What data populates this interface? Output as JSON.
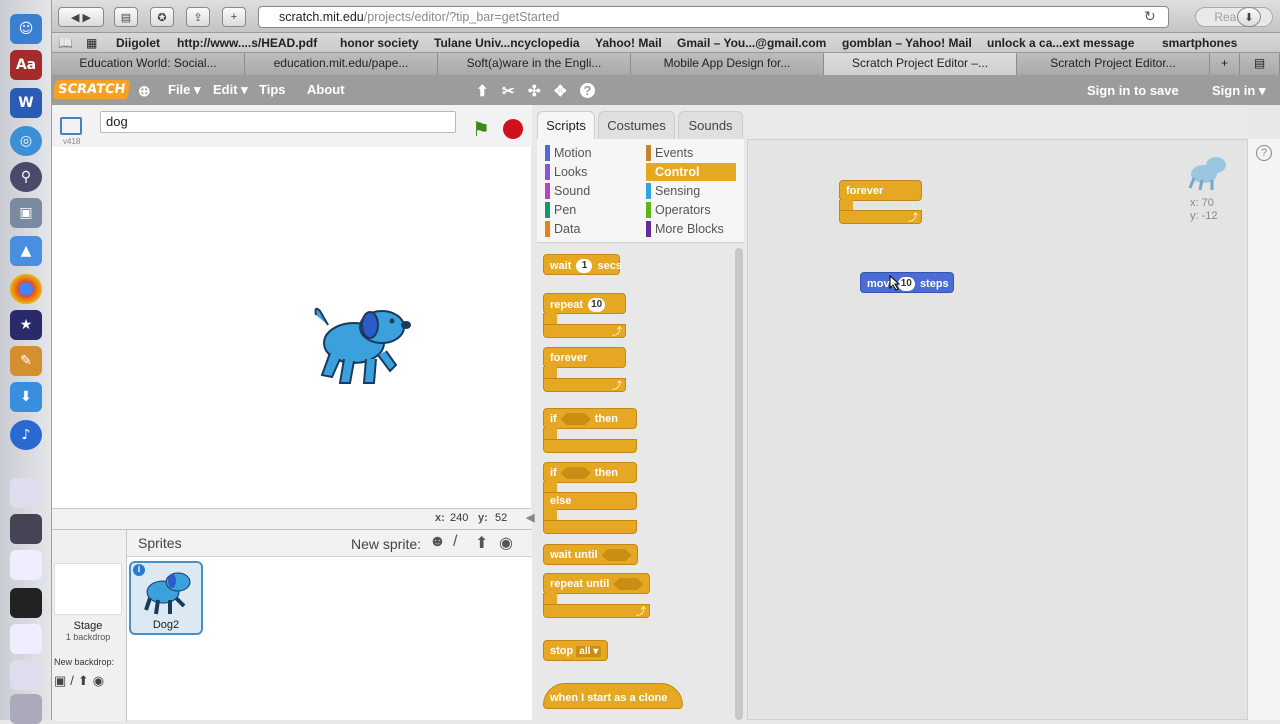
{
  "browser": {
    "url_host": "scratch.mit.edu",
    "url_path": "/projects/editor/?tip_bar=getStarted",
    "reader_label": "Reader"
  },
  "bookmarks": [
    "Diigolet",
    "http://www....s/HEAD.pdf",
    "honor society",
    "Tulane Univ...ncyclopedia",
    "Yahoo! Mail",
    "Gmail – You...@gmail.com",
    "gomblan – Yahoo! Mail",
    "unlock a ca...ext message",
    "smartphones"
  ],
  "tabs": [
    "Education World: Social...",
    "education.mit.edu/pape...",
    "Soft(a)ware in the Engli...",
    "Mobile App Design for...",
    "Scratch Project Editor –...",
    "Scratch Project Editor..."
  ],
  "menu": {
    "logo": "SCRATCH",
    "file": "File ▾",
    "edit": "Edit ▾",
    "tips": "Tips",
    "about": "About",
    "sign_in_save": "Sign in to save",
    "sign_in": "Sign in ▾"
  },
  "stage": {
    "version": "v418",
    "sprite_name": "dog",
    "mouse_x_label": "x:",
    "mouse_x": "240",
    "mouse_y_label": "y:",
    "mouse_y": "52"
  },
  "sprites_pane": {
    "title": "Sprites",
    "new_sprite": "New sprite:",
    "stage_label": "Stage",
    "stage_backdrops": "1 backdrop",
    "new_backdrop": "New backdrop:",
    "sprite_name": "Dog2"
  },
  "editor_tabs": [
    "Scripts",
    "Costumes",
    "Sounds"
  ],
  "categories": [
    {
      "label": "Motion",
      "color": "#4a6cd4"
    },
    {
      "label": "Looks",
      "color": "#8a55d7"
    },
    {
      "label": "Sound",
      "color": "#bb42c3"
    },
    {
      "label": "Pen",
      "color": "#0e9a6c"
    },
    {
      "label": "Data",
      "color": "#ee7d16"
    },
    {
      "label": "Events",
      "color": "#c88330"
    },
    {
      "label": "Control",
      "color": "#e1a91a"
    },
    {
      "label": "Sensing",
      "color": "#2ca5e2"
    },
    {
      "label": "Operators",
      "color": "#5cb712"
    },
    {
      "label": "More Blocks",
      "color": "#632d99"
    }
  ],
  "palette": {
    "wait": "wait",
    "wait_val": "1",
    "secs": "secs",
    "repeat": "repeat",
    "repeat_val": "10",
    "forever": "forever",
    "if": "if",
    "then": "then",
    "else": "else",
    "wait_until": "wait until",
    "repeat_until": "repeat until",
    "stop": "stop",
    "stop_val": "all ▾",
    "clone": "when I start as a clone"
  },
  "scripts": {
    "forever": "forever",
    "move": "move",
    "move_val": "10",
    "steps": "steps",
    "sprite_x": "x: 70",
    "sprite_y": "y: -12"
  }
}
